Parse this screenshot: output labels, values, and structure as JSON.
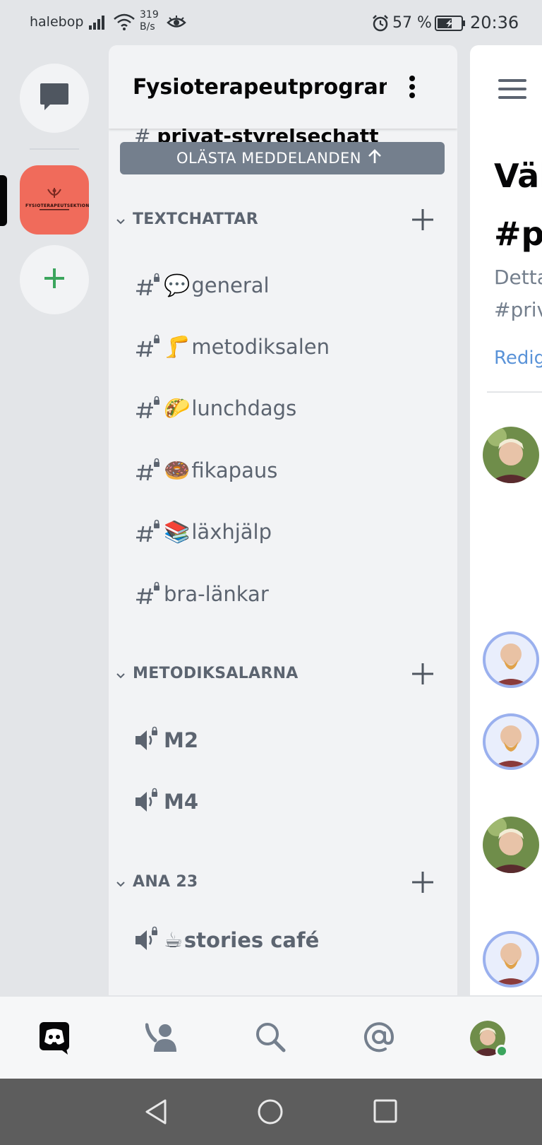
{
  "status_bar": {
    "carrier": "halebop",
    "net_speed_value": "319",
    "net_speed_unit": "B/s",
    "battery_percent": "57 %",
    "time": "20:36"
  },
  "server_rail": {
    "server_logo_text": "FYSIOTERAPEUTSEKTIONEN"
  },
  "channel_panel": {
    "server_name": "Fysioterapeutprogram...",
    "partial_channel": "privat-styrelsechatt",
    "unread_banner": "OLÄSTA MEDDELANDEN",
    "categories": [
      {
        "label": "TEXTCHATTAR",
        "channels": [
          {
            "emoji": "💬",
            "name": "general"
          },
          {
            "emoji": "🦵",
            "name": "metodiksalen"
          },
          {
            "emoji": "🌮",
            "name": "lunchdags"
          },
          {
            "emoji": "🍩",
            "name": "fikapaus"
          },
          {
            "emoji": "📚",
            "name": "läxhjälp"
          },
          {
            "emoji": "",
            "name": "bra-länkar"
          }
        ]
      },
      {
        "label": "METODIKSALARNA",
        "channels": [
          {
            "emoji": "",
            "name": "M2"
          },
          {
            "emoji": "",
            "name": "M4"
          }
        ]
      },
      {
        "label": "ANA 23",
        "channels": [
          {
            "emoji": "☕",
            "name": "stories café"
          }
        ]
      }
    ]
  },
  "chat_panel": {
    "welcome_line1": "Väl",
    "welcome_line2": "#pr",
    "desc_line1": "Detta",
    "desc_line2": "#priv",
    "edit_link": "Redig"
  },
  "colors": {
    "server_accent": "#f06b5b",
    "add_green": "#3ba55d",
    "link_blue": "#5a93d8",
    "online_green": "#3ba55d"
  }
}
